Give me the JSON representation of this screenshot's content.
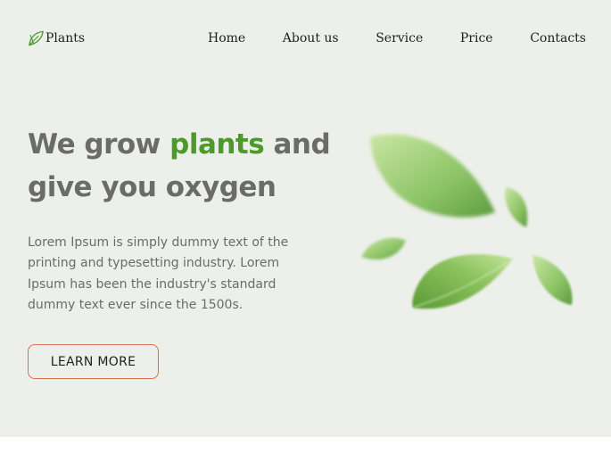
{
  "header": {
    "logo_text": "Plants",
    "nav": [
      "Home",
      "About us",
      "Service",
      "Price",
      "Contacts"
    ]
  },
  "hero": {
    "headline_pre": "We grow ",
    "headline_accent": "plants",
    "headline_post": " and give you oxygen",
    "description": "Lorem Ipsum is simply dummy text of the printing and typesetting industry. Lorem Ipsum has been the industry's standard dummy text ever since the 1500s.",
    "button_label": "LEARN MORE"
  },
  "colors": {
    "background": "#edf0ea",
    "accent_green": "#4d9a2a",
    "button_border": "#d8704a",
    "text_gray": "#6b6b6b"
  },
  "icons": {
    "logo": "leaf-icon",
    "illustration": "floating-leaves"
  }
}
